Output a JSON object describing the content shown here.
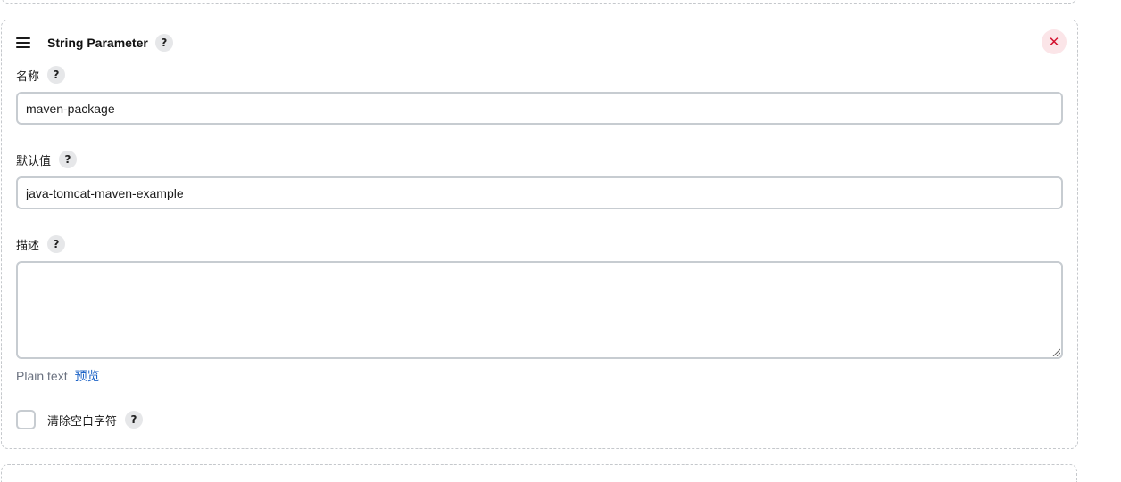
{
  "card": {
    "title": "String Parameter",
    "help_glyph": "?",
    "close_glyph": "✕",
    "icons": {
      "drag": "hamburger-icon",
      "close": "close-icon",
      "help": "help-icon"
    }
  },
  "fields": {
    "name": {
      "label": "名称",
      "value": "maven-package"
    },
    "default_value": {
      "label": "默认值",
      "value": "java-tomcat-maven-example"
    },
    "description": {
      "label": "描述",
      "value": ""
    }
  },
  "markup": {
    "plain_text": "Plain text",
    "preview_link": "预览"
  },
  "trim": {
    "label": "清除空白字符",
    "checked": false
  },
  "colors": {
    "close_bg": "#fbe5e8",
    "close_fg": "#d3112e",
    "link": "#1f65c7",
    "border": "#c7ccd1"
  }
}
